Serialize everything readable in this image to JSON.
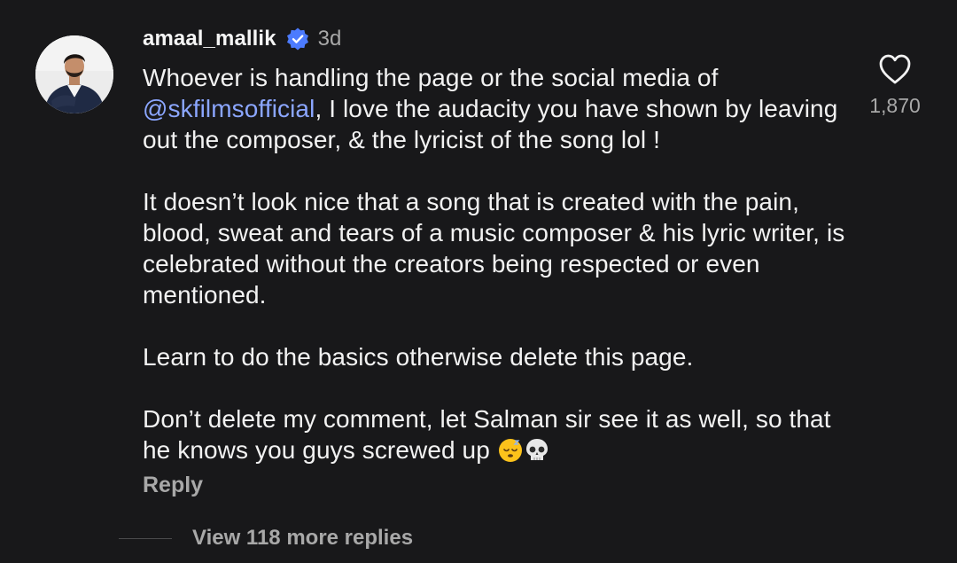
{
  "comment": {
    "username": "amaal_mallik",
    "timestamp": "3d",
    "verified": true,
    "paragraph1": {
      "before": "Whoever is handling the page or the social media of",
      "mention": "@skfilmsofficial",
      "after": ", I love the audacity you have shown by leaving out the composer, & the lyricist of the song lol !"
    },
    "paragraph2": "It doesn’t look nice that a song that is created with the pain, blood, sweat and tears of a music composer & his lyric writer, is celebrated without the creators being respected or even mentioned.",
    "paragraph3": "Learn to do the basics otherwise delete this page.",
    "paragraph4": "Don’t delete my comment, let Salman sir see it as well, so that he knows you guys screwed up",
    "emojis": [
      "sleeping-face-emoji",
      "skull-emoji"
    ],
    "reply_label": "Reply",
    "like_count": "1,870",
    "view_replies_label": "View 118 more replies"
  },
  "colors": {
    "background": "#18181a",
    "text": "#f2f2f2",
    "muted": "#a8a8a8",
    "mention": "#8ba6ff",
    "verified_badge": "#4c7bff"
  },
  "icons": [
    "verified-badge-icon",
    "heart-icon",
    "avatar"
  ]
}
